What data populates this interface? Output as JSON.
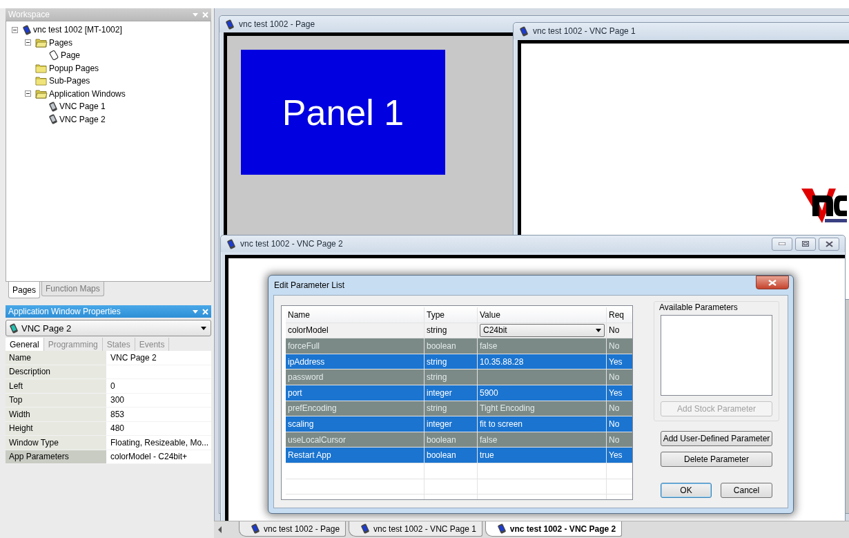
{
  "workspace": {
    "title": "Workspace",
    "tree": [
      {
        "label": "vnc test 1002 [MT-1002]",
        "kind": "project",
        "expanded": true,
        "children": [
          {
            "label": "Pages",
            "kind": "folder",
            "expanded": true,
            "children": [
              {
                "label": "Page",
                "kind": "page",
                "expanded": false
              }
            ]
          },
          {
            "label": "Popup Pages",
            "kind": "folder",
            "expanded": false
          },
          {
            "label": "Sub-Pages",
            "kind": "folder",
            "expanded": false
          },
          {
            "label": "Application Windows",
            "kind": "folder",
            "expanded": true,
            "children": [
              {
                "label": "VNC Page 1",
                "kind": "app",
                "expanded": false
              },
              {
                "label": "VNC Page 2",
                "kind": "app",
                "expanded": false
              }
            ]
          }
        ]
      }
    ],
    "tabs": [
      {
        "label": "Pages",
        "selected": true
      },
      {
        "label": "Function Maps",
        "selected": false
      }
    ]
  },
  "properties": {
    "title": "Application Window Properties",
    "object": "VNC Page 2",
    "tabs": [
      {
        "label": "General",
        "selected": true
      },
      {
        "label": "Programming",
        "selected": false
      },
      {
        "label": "States",
        "selected": false
      },
      {
        "label": "Events",
        "selected": false
      }
    ],
    "rows": [
      {
        "label": "Name",
        "value": "VNC Page 2",
        "selected": false
      },
      {
        "label": "Description",
        "selected": false
      },
      {
        "label": "Left",
        "value": "0",
        "selected": false
      },
      {
        "label": "Top",
        "value": "300",
        "selected": false
      },
      {
        "label": "Width",
        "value": "853",
        "selected": false
      },
      {
        "label": "Height",
        "value": "480",
        "selected": false
      },
      {
        "label": "Window Type",
        "value": "Floating, Resizeable, Mo...",
        "selected": false
      },
      {
        "label": "App Parameters",
        "value": "colorModel - C24bit+",
        "selected": true
      }
    ]
  },
  "windows": [
    {
      "title": "vnc test 1002 - Page",
      "kind": "page",
      "panel": "Panel 1"
    },
    {
      "title": "vnc test 1002 - VNC Page 1",
      "kind": "vnc"
    },
    {
      "title": "vnc test 1002 - VNC Page 2",
      "kind": "blank"
    }
  ],
  "dialog": {
    "title": "Edit Parameter List",
    "columns": [
      "Name",
      "Type",
      "Value",
      "Req"
    ],
    "rows": [
      {
        "name": "colorModel",
        "type": "string",
        "value": "C24bit",
        "req": "No",
        "kind": "combo",
        "selected": false
      },
      {
        "name": "forceFull",
        "type": "boolean",
        "value": "false",
        "req": "No",
        "kind": "text",
        "selected": true
      },
      {
        "name": "ipAddress",
        "type": "string",
        "value": "10.35.88.28",
        "req": "Yes",
        "kind": "text",
        "selected": true
      },
      {
        "name": "password",
        "type": "string",
        "req": "No",
        "kind": "text",
        "selected": true
      },
      {
        "name": "port",
        "type": "integer",
        "value": "5900",
        "req": "Yes",
        "kind": "text",
        "selected": true
      },
      {
        "name": "prefEncoding",
        "type": "string",
        "value": "Tight Encoding",
        "req": "No",
        "kind": "text",
        "selected": true
      },
      {
        "name": "scaling",
        "type": "integer",
        "value": "fit to screen",
        "req": "No",
        "kind": "text",
        "selected": true
      },
      {
        "name": "useLocalCursor",
        "type": "boolean",
        "value": "false",
        "req": "No",
        "kind": "text",
        "selected": true
      },
      {
        "name": "Restart App",
        "type": "boolean",
        "value": "true",
        "req": "Yes",
        "kind": "text",
        "selected": true
      }
    ],
    "available_title": "Available Parameters",
    "buttons": [
      {
        "label": "Add Stock Parameter",
        "disabled": true,
        "default": false
      },
      {
        "label": "Add User-Defined Parameter",
        "disabled": false,
        "default": false
      },
      {
        "label": "Delete Parameter",
        "disabled": false,
        "default": false
      },
      {
        "label": "OK",
        "disabled": false,
        "default": true
      },
      {
        "label": "Cancel",
        "disabled": false,
        "default": false
      }
    ]
  },
  "document_tabs": [
    {
      "label": "vnc test 1002 - Page",
      "selected": false
    },
    {
      "label": "vnc test 1002 - VNC Page 1",
      "selected": false
    },
    {
      "label": "vnc test 1002 - VNC Page 2",
      "selected": true
    }
  ]
}
